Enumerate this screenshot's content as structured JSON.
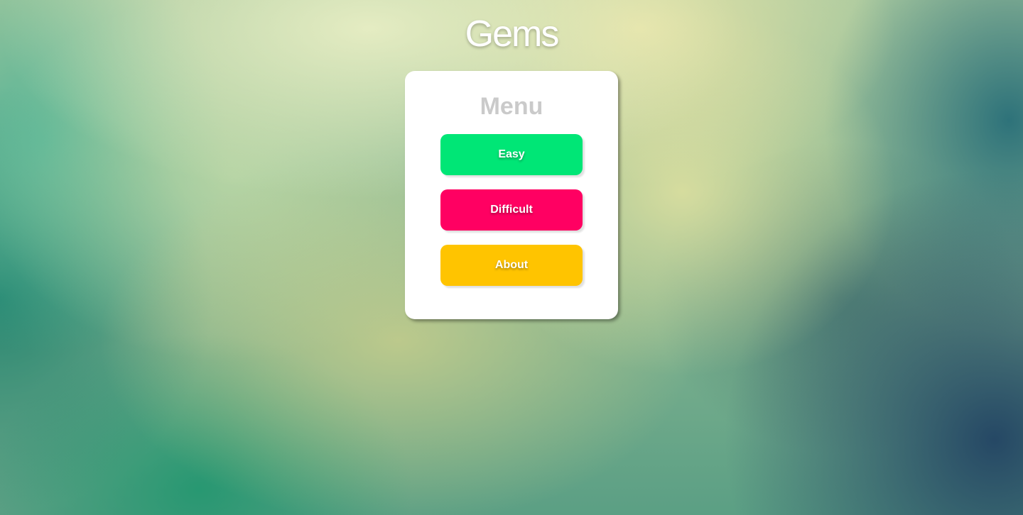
{
  "app": {
    "title": "Gems"
  },
  "menu": {
    "title": "Menu",
    "buttons": [
      {
        "label": "Easy",
        "color": "#00e676"
      },
      {
        "label": "Difficult",
        "color": "#ff0062"
      },
      {
        "label": "About",
        "color": "#ffc400"
      }
    ]
  },
  "colors": {
    "card_background": "#ffffff",
    "menu_title": "#cacaca",
    "button_text": "#ffffff"
  }
}
